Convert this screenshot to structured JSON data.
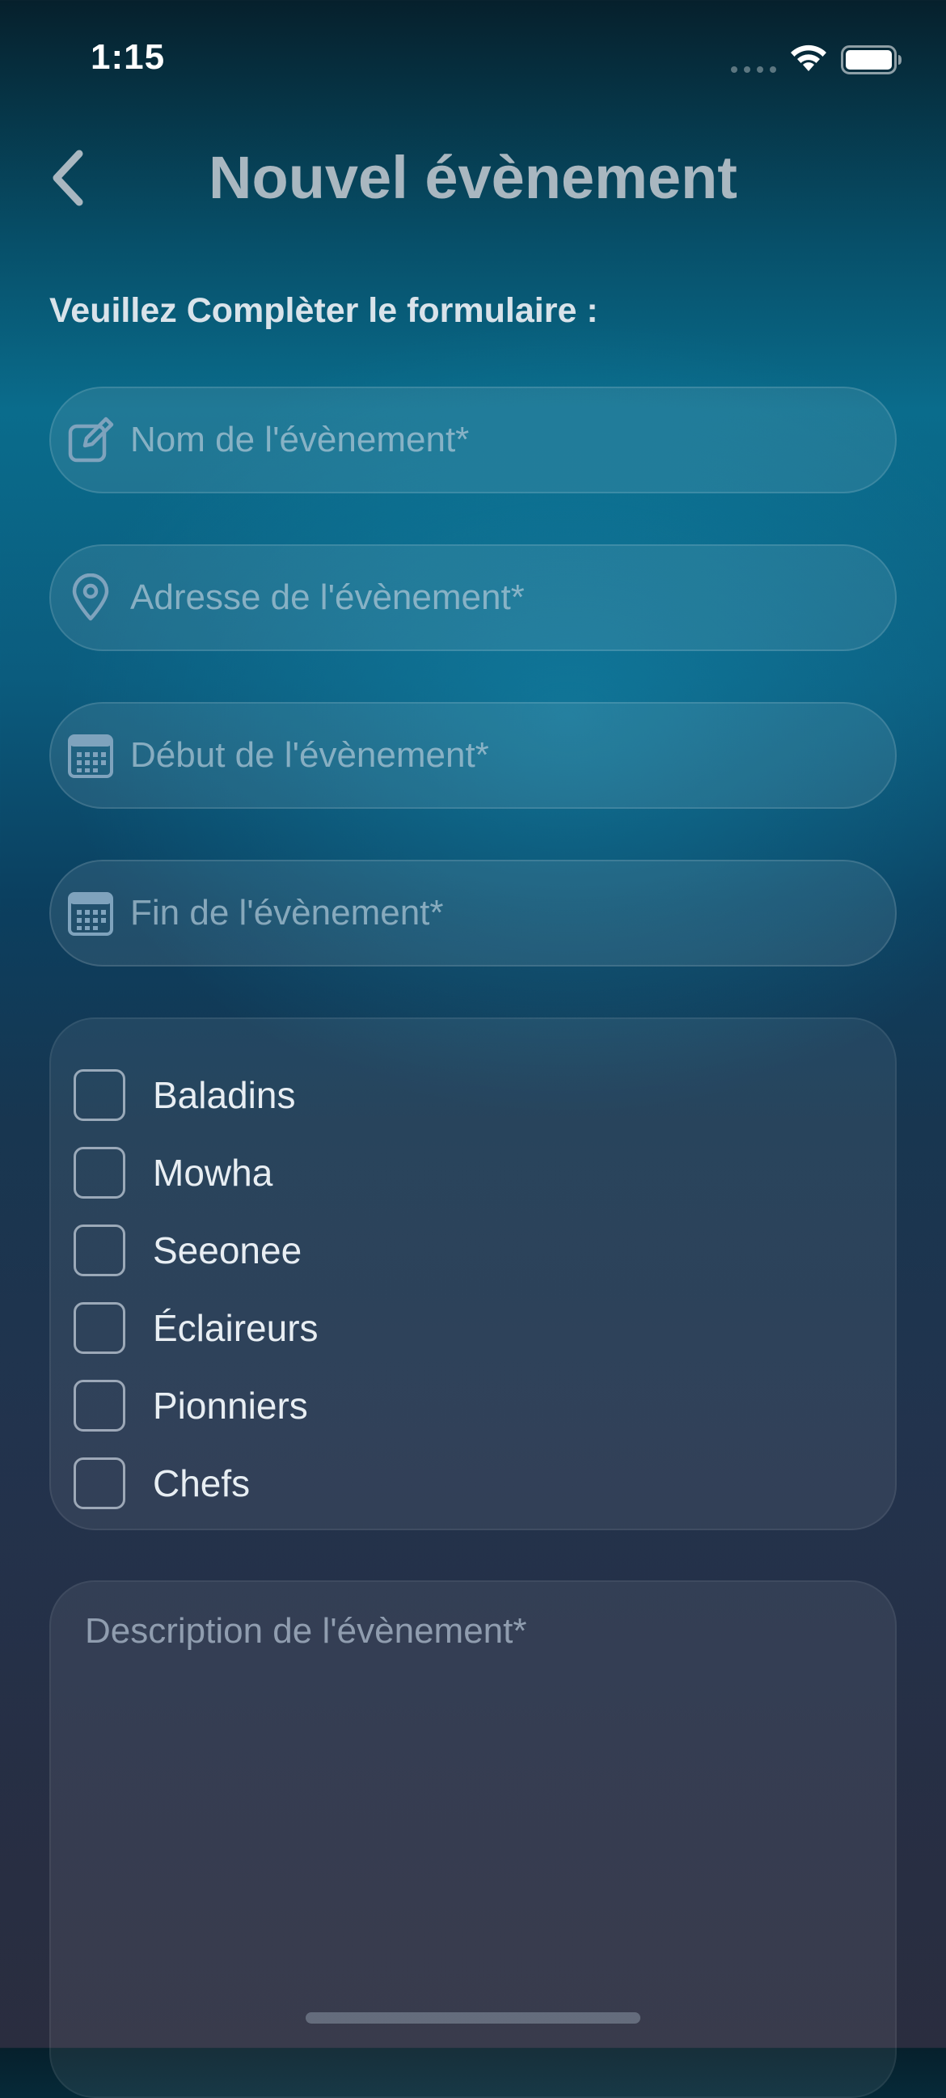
{
  "status_bar": {
    "time": "1:15"
  },
  "header": {
    "title": "Nouvel évènement"
  },
  "form": {
    "intro": "Veuillez Complèter le formulaire :",
    "fields": {
      "name": {
        "placeholder": "Nom de l'évènement*",
        "value": "",
        "icon": "edit-icon"
      },
      "address": {
        "placeholder": "Adresse de l'évènement*",
        "value": "",
        "icon": "location-pin-icon"
      },
      "start": {
        "placeholder": "Début de l'évènement*",
        "value": "",
        "icon": "calendar-icon"
      },
      "end": {
        "placeholder": "Fin de l'évènement*",
        "value": "",
        "icon": "calendar-icon"
      }
    },
    "groups": [
      {
        "label": "Baladins",
        "checked": false
      },
      {
        "label": "Mowha",
        "checked": false
      },
      {
        "label": "Seeonee",
        "checked": false
      },
      {
        "label": "Éclaireurs",
        "checked": false
      },
      {
        "label": "Pionniers",
        "checked": false
      },
      {
        "label": "Chefs",
        "checked": false
      }
    ],
    "description": {
      "placeholder": "Description de l'évènement*",
      "value": ""
    }
  },
  "colors": {
    "background_top": "#06202c",
    "background_mid": "#0a6c8c",
    "background_bottom": "#2a2d3f",
    "icon_tint": "#7fa3bd",
    "title": "#a9b7c0"
  }
}
